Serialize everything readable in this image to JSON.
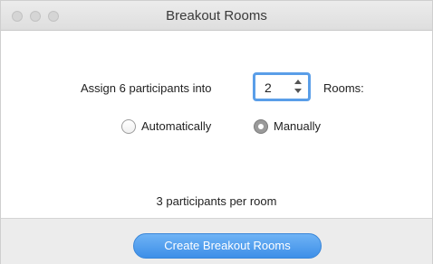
{
  "window": {
    "title": "Breakout Rooms"
  },
  "assign": {
    "prefix_label": "Assign 6 participants into",
    "room_count": "2",
    "suffix_label": "Rooms:"
  },
  "options": [
    {
      "label": "Automatically",
      "selected": false
    },
    {
      "label": "Manually",
      "selected": true
    }
  ],
  "summary": {
    "per_room_text": "3 participants per room"
  },
  "footer": {
    "create_label": "Create Breakout Rooms"
  },
  "colors": {
    "accent": "#4a9bee",
    "input_focus": "#5a9ee8"
  }
}
